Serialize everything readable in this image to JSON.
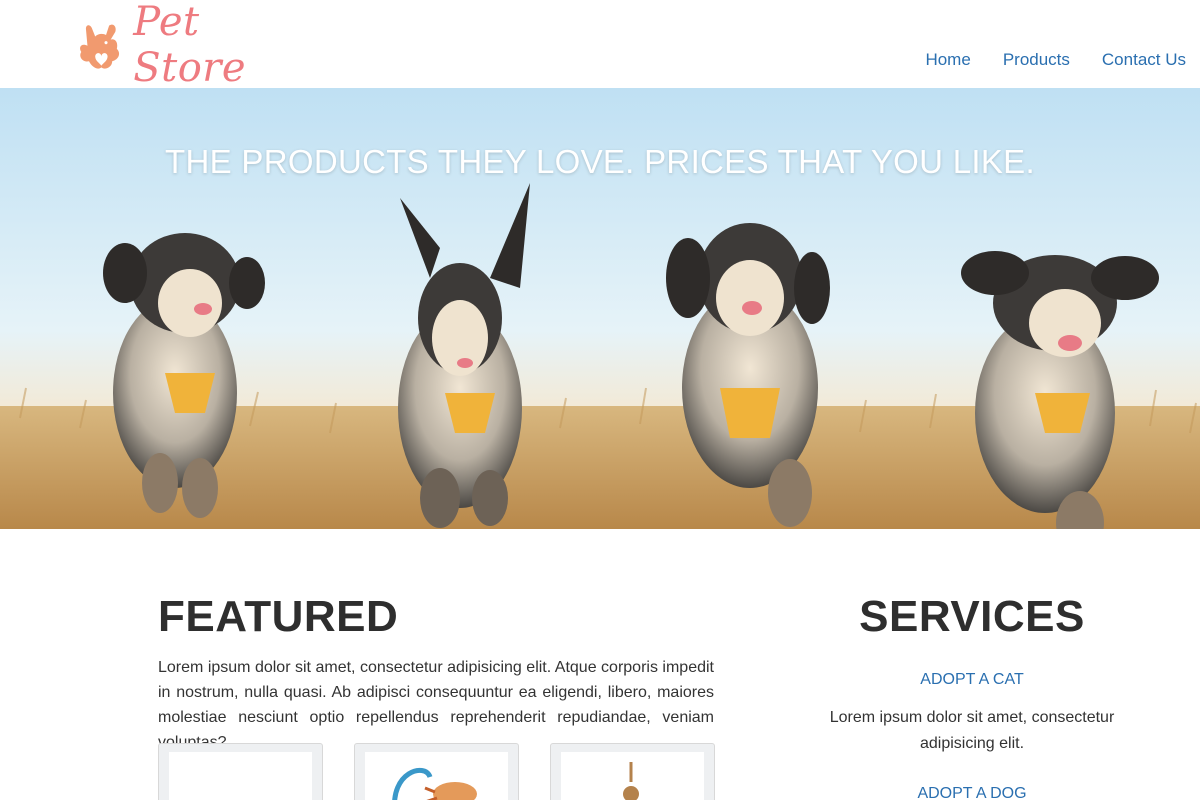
{
  "brand": {
    "name": "Pet Store",
    "logo_icon": "dog-heart-logo-icon",
    "accent": "#ee7b80"
  },
  "nav": {
    "items": [
      {
        "label": "Home"
      },
      {
        "label": "Products"
      },
      {
        "label": "Contact Us"
      }
    ],
    "link_color": "#2a6fb0"
  },
  "hero": {
    "title": "THE PRODUCTS THEY LOVE. PRICES THAT YOU LIKE.",
    "image": "four-dogs-running-in-field"
  },
  "featured": {
    "heading": "FEATURED",
    "text": "Lorem ipsum dolor sit amet, consectetur adipisicing elit. Atque corporis impedit in nostrum, nulla quasi. Ab adipisci consequuntur ea eligendi, libero, maiores molestiae nesciunt optio repellendus reprehenderit repudiandae, veniam voluptas?",
    "cards": [
      {
        "image": "product-image-blank"
      },
      {
        "image": "cat-toy-image"
      },
      {
        "image": "wooden-toy-image"
      }
    ]
  },
  "services": {
    "heading": "SERVICES",
    "items": [
      {
        "label": "ADOPT A CAT",
        "text": "Lorem ipsum dolor sit amet, consectetur adipisicing elit."
      },
      {
        "label": "ADOPT A DOG"
      }
    ]
  }
}
